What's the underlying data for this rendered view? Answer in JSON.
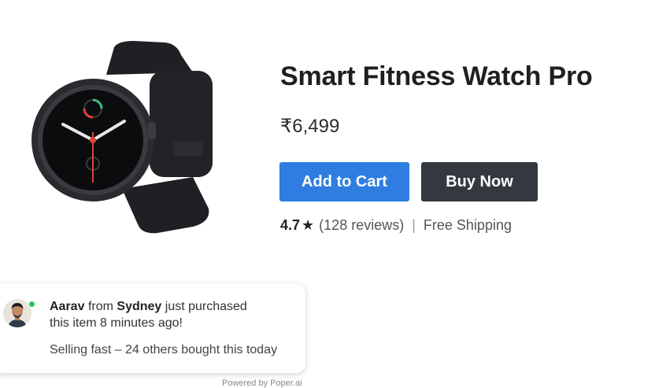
{
  "product": {
    "title": "Smart Fitness Watch Pro",
    "price": "₹6,499",
    "image_alt": "Smart fitness watch"
  },
  "actions": {
    "add_to_cart": "Add to Cart",
    "buy_now": "Buy Now"
  },
  "meta": {
    "rating": "4.7",
    "star": "★",
    "reviews": "(128 reviews)",
    "separator": "|",
    "shipping": "Free Shipping"
  },
  "notification": {
    "name": "Aarav",
    "from_text": "from",
    "city": "Sydney",
    "action": "just purchased",
    "line2": "this item 8 minutes ago!",
    "line3": "Selling fast – 24 others bought this today"
  },
  "footer": {
    "powered_by": "Powered by Poper.ai"
  },
  "colors": {
    "primary": "#2f7de0",
    "dark_button": "#34383f",
    "online": "#22c55e"
  }
}
